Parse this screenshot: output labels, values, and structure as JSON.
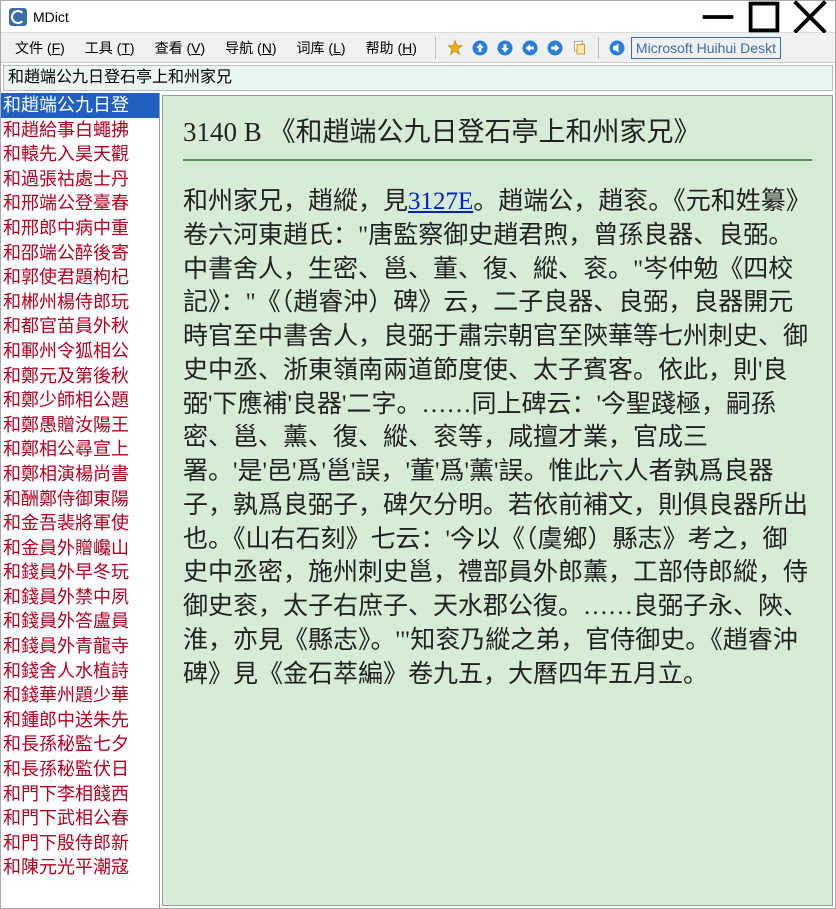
{
  "window": {
    "title": "MDict"
  },
  "menus": [
    {
      "label": "文件",
      "mn": "F"
    },
    {
      "label": "工具",
      "mn": "T"
    },
    {
      "label": "查看",
      "mn": "V"
    },
    {
      "label": "导航",
      "mn": "N"
    },
    {
      "label": "词库",
      "mn": "L"
    },
    {
      "label": "帮助",
      "mn": "H"
    }
  ],
  "toolbar": {
    "tts_label": "Microsoft Huihui Deskt"
  },
  "search": {
    "value": "和趙端公九日登石亭上和州家兄"
  },
  "sidebar": {
    "selected_index": 0,
    "items": [
      "和趙端公九日登",
      "和趙給事白蠅拂",
      "和轅先入昊天觀",
      "和過張祜處士丹",
      "和邢端公登臺春",
      "和邢郎中病中重",
      "和邵端公醉後寄",
      "和郭使君題枸杞",
      "和郴州楊侍郎玩",
      "和都官苗員外秋",
      "和鄆州令狐相公",
      "和鄭元及第後秋",
      "和鄭少師相公題",
      "和鄭愚贈汝陽王",
      "和鄭相公尋宣上",
      "和鄭相演楊尚書",
      "和酬鄭侍御東陽",
      "和金吾裴將軍使",
      "和金員外贈巉山",
      "和錢員外早冬玩",
      "和錢員外禁中夙",
      "和錢員外答盧員",
      "和錢員外青龍寺",
      "和錢舍人水植詩",
      "和錢華州題少華",
      "和鍾郎中送朱先",
      "和長孫秘監七夕",
      "和長孫秘監伏日",
      "和門下李相餞西",
      "和門下武相公春",
      "和門下殷侍郎新",
      "和陳元光平潮寇"
    ]
  },
  "entry": {
    "number": "3140 B",
    "title": "《和趙端公九日登石亭上和州家兄》",
    "body_pre": "和州家兄，趙縱，見",
    "link_text": "3127E",
    "body_post": "。趙端公，趙衮。《元和姓纂》卷六河東趙氏：\"唐監察御史趙君煦，曾孫良器、良弼。中書舍人，生密、邕、董、復、縱、衮。\"岑仲勉《四校記》：\"《（趙睿沖）碑》云，二子良器、良弼，良器開元時官至中書舍人，良弼于肅宗朝官至陝華等七州刺史、御史中丞、浙東嶺南兩道節度使、太子賓客。依此，則'良弼'下應補'良器'二字。……同上碑云：'今聖踐極，嗣孫密、邕、薰、復、縱、衮等，咸擅才業，官成三署。'是'邑'爲'邕'誤，'董'爲'薰'誤。惟此六人者孰爲良器子，孰爲良弼子，碑欠分明。若依前補文，則俱良器所出也。《山右石刻》七云：'今以《（虞鄉）縣志》考之，御史中丞密，施州刺史邕，禮部員外郎薰，工部侍郎縱，侍御史衮，太子右庶子、天水郡公復。……良弼子永、陝、淮，亦見《縣志》。'\"知衮乃縱之弟，官侍御史。《趙睿沖碑》見《金石萃編》卷九五，大曆四年五月立。"
  }
}
